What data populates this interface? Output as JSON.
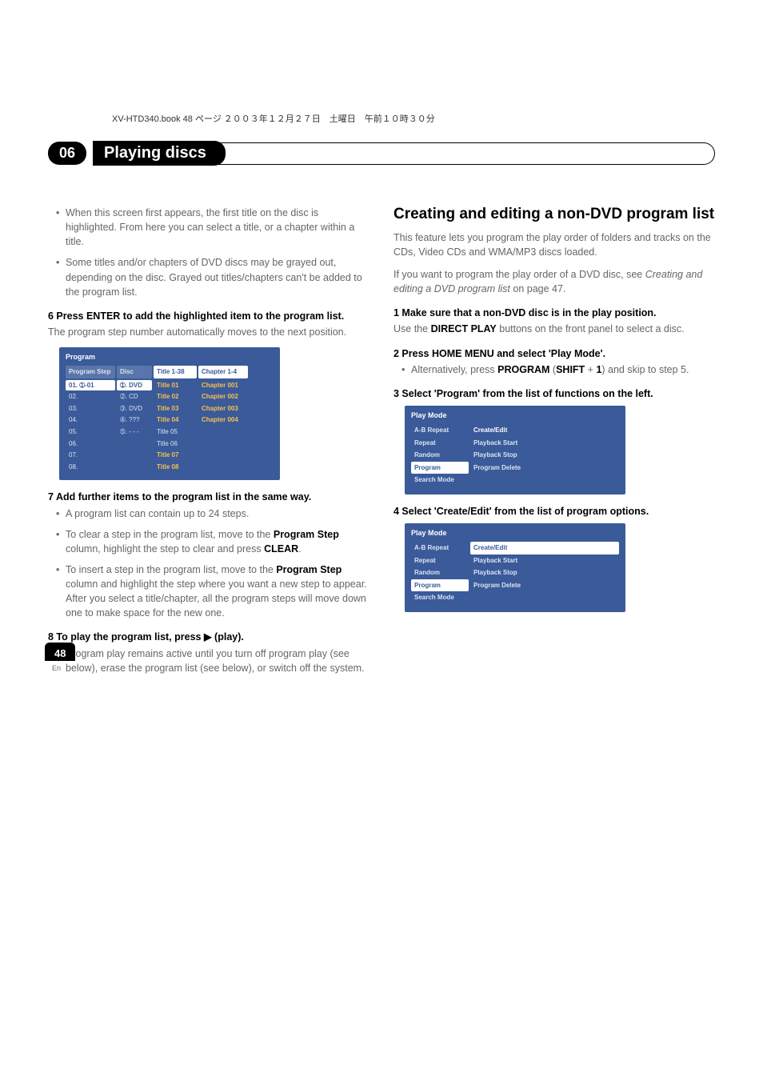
{
  "headerLine": "XV-HTD340.book  48 ページ  ２００３年１２月２７日　土曜日　午前１０時３０分",
  "chapterNum": "06",
  "chapterTitle": "Playing discs",
  "pageNum": "48",
  "pageLang": "En",
  "left": {
    "bullets1": [
      "When this screen first appears, the first title on the disc is highlighted. From here you can select a title, or a chapter within a title.",
      "Some titles and/or chapters of DVD discs may be grayed out, depending on the disc. Grayed out titles/chapters can't be added to the program list."
    ],
    "step6h": "6    Press ENTER to add the highlighted item to the program list.",
    "step6t": "The program step number automatically moves to the next position.",
    "progTitle": "Program",
    "progCols": {
      "step": {
        "h": "Program Step",
        "rows": [
          "01. ➀-01",
          "02.",
          "03.",
          "04.",
          "05.",
          "06.",
          "07.",
          "08."
        ]
      },
      "disc": {
        "h": "Disc",
        "rows": [
          "➀. DVD",
          "➁. CD",
          "➂. DVD",
          "➃. ???",
          "➄. - - -"
        ]
      },
      "title": {
        "h": "Title 1-38",
        "rows": [
          "Title 01",
          "Title 02",
          "Title 03",
          "Title 04",
          "Title 05",
          "Title 06",
          "Title 07",
          "Title 08"
        ]
      },
      "chap": {
        "h": "Chapter 1-4",
        "rows": [
          "Chapter 001",
          "Chapter 002",
          "Chapter 003",
          "Chapter 004"
        ]
      }
    },
    "step7h": "7    Add further items to the program list in the same way.",
    "bullets7": [
      "A program list can contain up to 24 steps.",
      "To clear a step in the program list, move to the <b>Program Step</b> column, highlight the step to clear and press <b>CLEAR</b>.",
      "To insert a step in the program list, move to the <b>Program Step</b> column and highlight the step where you want a new step to appear. After you select a title/chapter, all the program steps will move down one to make space for the new one."
    ],
    "step8h": "8    To play the program list, press ▶ (play).",
    "bullets8": [
      "Program play remains active until you turn off program play (see below), erase the program list (see below), or switch off the system."
    ]
  },
  "right": {
    "h2": "Creating and editing a non-DVD program list",
    "intro1": "This feature lets you program the play order of folders and tracks on the CDs, Video CDs and WMA/MP3 discs loaded.",
    "intro2pre": "If you want to program the play order of a DVD disc, see ",
    "intro2ital": "Creating and editing a DVD program list",
    "intro2post": " on page 47.",
    "step1h": "1    Make sure that a non-DVD disc is in the play position.",
    "step1t_pre": "Use the ",
    "step1t_bold": "DIRECT PLAY",
    "step1t_post": " buttons on the front panel to select a disc.",
    "step2h": "2    Press HOME MENU and select 'Play Mode'.",
    "step2b_pre": "Alternatively, press ",
    "step2b_b1": "PROGRAM",
    "step2b_mid": " (",
    "step2b_b2": "SHIFT",
    "step2b_plus": " + ",
    "step2b_b3": "1",
    "step2b_post": ") and skip to step 5.",
    "step3h": "3    Select 'Program' from the list of functions on the left.",
    "ui1": {
      "title": "Play Mode",
      "left": [
        "A-B Repeat",
        "Repeat",
        "Random",
        "Program",
        "Search Mode"
      ],
      "right": [
        "Create/Edit",
        "Playback Start",
        "Playback Stop",
        "Program Delete"
      ],
      "leftSel": "Program",
      "rightSel": "Create/Edit"
    },
    "step4h": "4    Select 'Create/Edit' from the list of program options.",
    "ui2": {
      "title": "Play Mode",
      "left": [
        "A-B Repeat",
        "Repeat",
        "Random",
        "Program",
        "Search Mode"
      ],
      "right": [
        "Create/Edit",
        "Playback Start",
        "Playback Stop",
        "Program Delete"
      ],
      "leftSel": "Program",
      "rightSel": "Create/Edit"
    }
  }
}
